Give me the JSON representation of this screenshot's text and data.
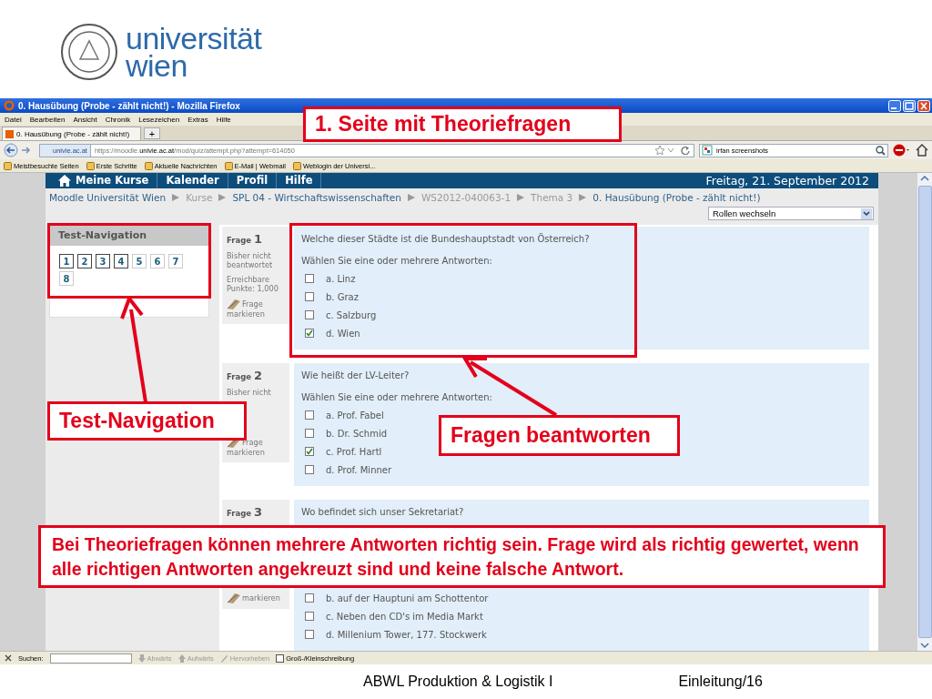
{
  "slide": {
    "logo": {
      "lines": [
        "universität",
        "wien"
      ]
    },
    "footer": {
      "course": "ABWL Produktion & Logistik I",
      "page": "Einleitung/16"
    }
  },
  "browser": {
    "title": "0. Hausübung (Probe - zählt nicht!) - Mozilla Firefox",
    "menu": [
      "Datei",
      "Bearbeiten",
      "Ansicht",
      "Chronik",
      "Lesezeichen",
      "Extras",
      "Hilfe"
    ],
    "tabs": [
      {
        "label": "0. Hausübung (Probe - zählt nicht!)",
        "selected": true
      }
    ],
    "new_tab": "+",
    "site_badge": "univie.ac.at",
    "url": "https://moodle.**univie.ac.at**/mod/quiz/attempt.php?attempt=614050",
    "search_value": "irfan screenshots",
    "bookmarks": [
      "Meistbesuchte Seiten",
      "Erste Schritte",
      "Aktuelle Nachrichten",
      "E-Mail | Webmail",
      "Weblogin der Universi..."
    ],
    "find_bar": {
      "label": "Suchen:",
      "buttons": [
        "Abwärts",
        "Aufwärts",
        "Hervorheben"
      ],
      "match_case": {
        "label": "Groß-/Kleinschreibung",
        "checked": false
      }
    }
  },
  "moodle": {
    "nav": [
      "Meine Kurse",
      "Kalender",
      "Profil",
      "Hilfe"
    ],
    "date": "Freitag, 21. September 2012",
    "breadcrumb": [
      {
        "label": "Moodle Universität Wien",
        "link": true
      },
      {
        "label": "Kurse",
        "link": false
      },
      {
        "label": "SPL 04 - Wirtschaftswissenschaften",
        "link": true
      },
      {
        "label": "WS2012-040063-1",
        "link": false
      },
      {
        "label": "Thema 3",
        "link": false
      },
      {
        "label": "0. Hausübung (Probe - zählt nicht!)",
        "link": true
      }
    ],
    "role_select": "Rollen wechseln",
    "quiz_nav": {
      "title": "Test-Navigation",
      "buttons": [
        {
          "label": "1",
          "answered": true
        },
        {
          "label": "2",
          "answered": true
        },
        {
          "label": "3",
          "answered": true
        },
        {
          "label": "4",
          "answered": true
        },
        {
          "label": "5",
          "answered": false
        },
        {
          "label": "6",
          "answered": false
        },
        {
          "label": "7",
          "answered": false
        },
        {
          "label": "8",
          "answered": false
        }
      ]
    },
    "questions": [
      {
        "label": "Frage",
        "number": "1",
        "status": "Bisher nicht beantwortet",
        "points": "Erreichbare Punkte: 1,000",
        "flag": "Frage markieren",
        "text": "Welche dieser Städte ist die Bundeshauptstadt von Österreich?",
        "intro": "Wählen Sie eine oder mehrere Antworten:",
        "options": [
          {
            "label": "a. Linz",
            "checked": false
          },
          {
            "label": "b. Graz",
            "checked": false
          },
          {
            "label": "c. Salzburg",
            "checked": false
          },
          {
            "label": "d. Wien",
            "checked": true
          }
        ]
      },
      {
        "label": "Frage",
        "number": "2",
        "status": "Bisher nicht",
        "flag": "Frage markieren",
        "text": "Wie heißt der LV-Leiter?",
        "intro": "Wählen Sie eine oder mehrere Antworten:",
        "options": [
          {
            "label": "a. Prof. Fabel",
            "checked": false
          },
          {
            "label": "b. Dr. Schmid",
            "checked": false
          },
          {
            "label": "c. Prof. Hartl",
            "checked": true
          },
          {
            "label": "d. Prof. Minner",
            "checked": false
          }
        ]
      },
      {
        "label": "Frage",
        "number": "3",
        "flag": "markieren",
        "text": "Wo befindet sich unser Sekretariat?",
        "options": [
          {
            "label": "b. auf der Hauptuni am Schottentor",
            "checked": false
          },
          {
            "label": "c. Neben den CD's im Media Markt",
            "checked": false
          },
          {
            "label": "d. Millenium Tower, 177. Stockwerk",
            "checked": false
          }
        ]
      }
    ]
  },
  "annotations": [
    {
      "kind": "label",
      "text": "1. Seite mit Theoriefragen"
    },
    {
      "kind": "frame"
    },
    {
      "kind": "arrow"
    },
    {
      "kind": "label",
      "text": "Test-Navigation"
    },
    {
      "kind": "frame"
    },
    {
      "kind": "arrow"
    },
    {
      "kind": "label",
      "text": "Fragen beantworten"
    },
    {
      "kind": "label",
      "text": "Bei Theoriefragen können mehrere Antworten richtig sein. Frage wird als richtig gewertet, wenn alle richtigen Antworten angekreuzt sind und keine falsche Antwort."
    }
  ]
}
